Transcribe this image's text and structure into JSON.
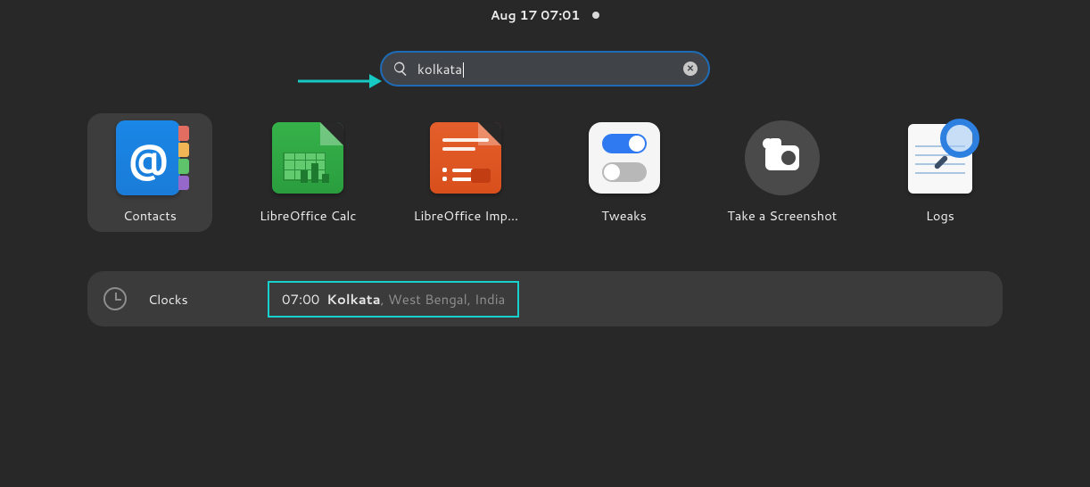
{
  "topbar": {
    "datetime": "Aug 17  07:01"
  },
  "search": {
    "query": "kolkata"
  },
  "apps": [
    {
      "id": "contacts",
      "label": "Contacts"
    },
    {
      "id": "calc",
      "label": "LibreOffice Calc"
    },
    {
      "id": "impress",
      "label": "LibreOffice Imp…"
    },
    {
      "id": "tweaks",
      "label": "Tweaks"
    },
    {
      "id": "screenshot",
      "label": "Take a Screenshot"
    },
    {
      "id": "logs",
      "label": "Logs"
    }
  ],
  "result": {
    "section": "Clocks",
    "time": "07:00",
    "city": "Kolkata",
    "suffix": ", West Bengal, India"
  }
}
